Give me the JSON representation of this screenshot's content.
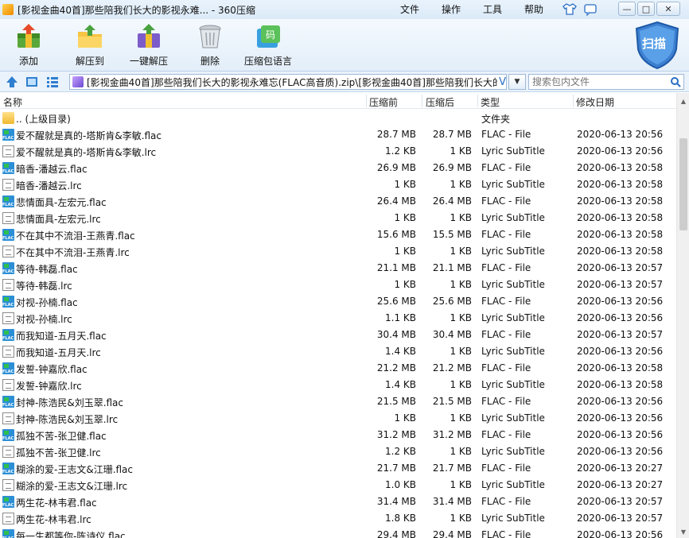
{
  "window": {
    "title": "[影视金曲40首]那些陪我们长大的影视永难... - 360压缩",
    "menu": [
      "文件",
      "操作",
      "工具",
      "帮助"
    ],
    "controls": {
      "minimize": "—",
      "maximize": "□",
      "close": "✕"
    }
  },
  "toolbar": {
    "add": "添加",
    "extract_to": "解压到",
    "one_click_extract": "一键解压",
    "delete": "删除",
    "encoding": "压缩包语言",
    "scan": "扫描",
    "encoding_badge": "码"
  },
  "address": {
    "path": "[影视金曲40首]那些陪我们长大的影视永难忘(FLAC高音质).zip\\[影视金曲40首]那些陪我们长大的",
    "overflow_marker": "V",
    "search_placeholder": "搜索包内文件"
  },
  "columns": {
    "name": "名称",
    "packed": "压缩前",
    "unpacked": "压缩后",
    "type": "类型",
    "modified": "修改日期"
  },
  "rows": [
    {
      "icon": "folder",
      "name": ".. (上级目录)",
      "packed": "",
      "unpacked": "",
      "type": "文件夹",
      "date": ""
    },
    {
      "icon": "flac",
      "name": "爱不醒就是真的-塔斯肯&李敏.flac",
      "packed": "28.7 MB",
      "unpacked": "28.7 MB",
      "type": "FLAC - File",
      "date": "2020-06-13 20:56"
    },
    {
      "icon": "lrc",
      "name": "爱不醒就是真的-塔斯肯&李敏.lrc",
      "packed": "1.2 KB",
      "unpacked": "1 KB",
      "type": "Lyric SubTitle",
      "date": "2020-06-13 20:56"
    },
    {
      "icon": "flac",
      "name": "暗香-潘越云.flac",
      "packed": "26.9 MB",
      "unpacked": "26.9 MB",
      "type": "FLAC - File",
      "date": "2020-06-13 20:58"
    },
    {
      "icon": "lrc",
      "name": "暗香-潘越云.lrc",
      "packed": "1 KB",
      "unpacked": "1 KB",
      "type": "Lyric SubTitle",
      "date": "2020-06-13 20:58"
    },
    {
      "icon": "flac",
      "name": "悲情面具-左宏元.flac",
      "packed": "26.4 MB",
      "unpacked": "26.4 MB",
      "type": "FLAC - File",
      "date": "2020-06-13 20:58"
    },
    {
      "icon": "lrc",
      "name": "悲情面具-左宏元.lrc",
      "packed": "1 KB",
      "unpacked": "1 KB",
      "type": "Lyric SubTitle",
      "date": "2020-06-13 20:58"
    },
    {
      "icon": "flac",
      "name": "不在其中不流泪-王燕青.flac",
      "packed": "15.6 MB",
      "unpacked": "15.5 MB",
      "type": "FLAC - File",
      "date": "2020-06-13 20:58"
    },
    {
      "icon": "lrc",
      "name": "不在其中不流泪-王燕青.lrc",
      "packed": "1 KB",
      "unpacked": "1 KB",
      "type": "Lyric SubTitle",
      "date": "2020-06-13 20:58"
    },
    {
      "icon": "flac",
      "name": "等待-韩磊.flac",
      "packed": "21.1 MB",
      "unpacked": "21.1 MB",
      "type": "FLAC - File",
      "date": "2020-06-13 20:57"
    },
    {
      "icon": "lrc",
      "name": "等待-韩磊.lrc",
      "packed": "1 KB",
      "unpacked": "1 KB",
      "type": "Lyric SubTitle",
      "date": "2020-06-13 20:57"
    },
    {
      "icon": "flac",
      "name": "对视-孙楠.flac",
      "packed": "25.6 MB",
      "unpacked": "25.6 MB",
      "type": "FLAC - File",
      "date": "2020-06-13 20:56"
    },
    {
      "icon": "lrc",
      "name": "对视-孙楠.lrc",
      "packed": "1.1 KB",
      "unpacked": "1 KB",
      "type": "Lyric SubTitle",
      "date": "2020-06-13 20:56"
    },
    {
      "icon": "flac",
      "name": "而我知道-五月天.flac",
      "packed": "30.4 MB",
      "unpacked": "30.4 MB",
      "type": "FLAC - File",
      "date": "2020-06-13 20:57"
    },
    {
      "icon": "lrc",
      "name": "而我知道-五月天.lrc",
      "packed": "1.4 KB",
      "unpacked": "1 KB",
      "type": "Lyric SubTitle",
      "date": "2020-06-13 20:56"
    },
    {
      "icon": "flac",
      "name": "发誓-钟嘉欣.flac",
      "packed": "21.2 MB",
      "unpacked": "21.2 MB",
      "type": "FLAC - File",
      "date": "2020-06-13 20:58"
    },
    {
      "icon": "lrc",
      "name": "发誓-钟嘉欣.lrc",
      "packed": "1.4 KB",
      "unpacked": "1 KB",
      "type": "Lyric SubTitle",
      "date": "2020-06-13 20:58"
    },
    {
      "icon": "flac",
      "name": "封神-陈浩民&刘玉翠.flac",
      "packed": "21.5 MB",
      "unpacked": "21.5 MB",
      "type": "FLAC - File",
      "date": "2020-06-13 20:56"
    },
    {
      "icon": "lrc",
      "name": "封神-陈浩民&刘玉翠.lrc",
      "packed": "1 KB",
      "unpacked": "1 KB",
      "type": "Lyric SubTitle",
      "date": "2020-06-13 20:56"
    },
    {
      "icon": "flac",
      "name": "孤独不苦-张卫健.flac",
      "packed": "31.2 MB",
      "unpacked": "31.2 MB",
      "type": "FLAC - File",
      "date": "2020-06-13 20:56"
    },
    {
      "icon": "lrc",
      "name": "孤独不苦-张卫健.lrc",
      "packed": "1.2 KB",
      "unpacked": "1 KB",
      "type": "Lyric SubTitle",
      "date": "2020-06-13 20:56"
    },
    {
      "icon": "flac",
      "name": "糊涂的爱-王志文&江珊.flac",
      "packed": "21.7 MB",
      "unpacked": "21.7 MB",
      "type": "FLAC - File",
      "date": "2020-06-13 20:27"
    },
    {
      "icon": "lrc",
      "name": "糊涂的爱-王志文&江珊.lrc",
      "packed": "1.0 KB",
      "unpacked": "1 KB",
      "type": "Lyric SubTitle",
      "date": "2020-06-13 20:27"
    },
    {
      "icon": "flac",
      "name": "两生花-林韦君.flac",
      "packed": "31.4 MB",
      "unpacked": "31.4 MB",
      "type": "FLAC - File",
      "date": "2020-06-13 20:57"
    },
    {
      "icon": "lrc",
      "name": "两生花-林韦君.lrc",
      "packed": "1.8 KB",
      "unpacked": "1 KB",
      "type": "Lyric SubTitle",
      "date": "2020-06-13 20:57"
    },
    {
      "icon": "flac",
      "name": "每一生都等你-陈诗仪.flac",
      "packed": "29.4 MB",
      "unpacked": "29.4 MB",
      "type": "FLAC - File",
      "date": "2020-06-13 20:56"
    }
  ]
}
